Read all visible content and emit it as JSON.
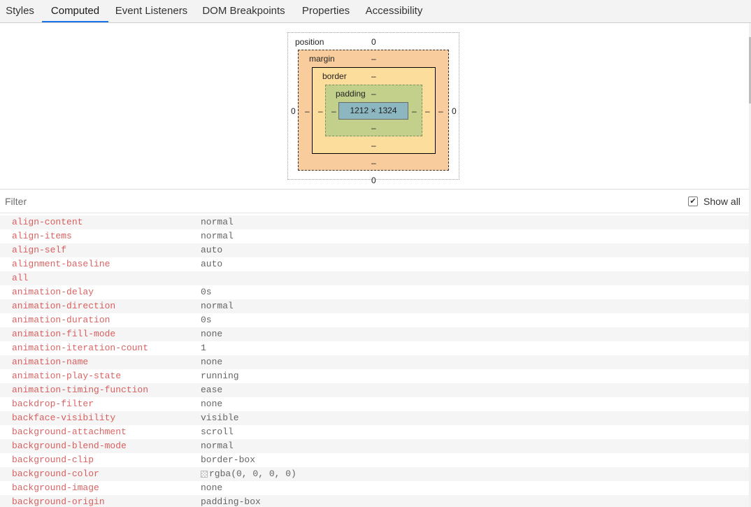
{
  "tabs": [
    {
      "label": "Styles"
    },
    {
      "label": "Computed"
    },
    {
      "label": "Event Listeners"
    },
    {
      "label": "DOM Breakpoints"
    },
    {
      "label": "Properties"
    },
    {
      "label": "Accessibility"
    }
  ],
  "active_tab": "Computed",
  "box_model": {
    "position_label": "position",
    "position_top": "0",
    "position_left": "0",
    "position_right": "0",
    "position_bottom": "0",
    "margin_label": "margin",
    "margin_top": "–",
    "margin_left": "–",
    "margin_right": "–",
    "margin_bottom": "–",
    "border_label": "border",
    "border_top": "–",
    "border_left": "–",
    "border_right": "–",
    "border_bottom": "–",
    "padding_label": "padding",
    "padding_top": "–",
    "padding_left": "–",
    "padding_right": "–",
    "padding_bottom": "–",
    "content_size": "1212 × 1324"
  },
  "filter": {
    "placeholder": "Filter",
    "value": ""
  },
  "show_all": {
    "label": "Show all",
    "checked": true,
    "check_glyph": "✔"
  },
  "properties": [
    {
      "name": "align-content",
      "value": "normal"
    },
    {
      "name": "align-items",
      "value": "normal"
    },
    {
      "name": "align-self",
      "value": "auto"
    },
    {
      "name": "alignment-baseline",
      "value": "auto"
    },
    {
      "name": "all",
      "value": ""
    },
    {
      "name": "animation-delay",
      "value": "0s"
    },
    {
      "name": "animation-direction",
      "value": "normal"
    },
    {
      "name": "animation-duration",
      "value": "0s"
    },
    {
      "name": "animation-fill-mode",
      "value": "none"
    },
    {
      "name": "animation-iteration-count",
      "value": "1"
    },
    {
      "name": "animation-name",
      "value": "none"
    },
    {
      "name": "animation-play-state",
      "value": "running"
    },
    {
      "name": "animation-timing-function",
      "value": "ease"
    },
    {
      "name": "backdrop-filter",
      "value": "none"
    },
    {
      "name": "backface-visibility",
      "value": "visible"
    },
    {
      "name": "background-attachment",
      "value": "scroll"
    },
    {
      "name": "background-blend-mode",
      "value": "normal"
    },
    {
      "name": "background-clip",
      "value": "border-box"
    },
    {
      "name": "background-color",
      "value": "rgba(0, 0, 0, 0)",
      "swatch": true
    },
    {
      "name": "background-image",
      "value": "none"
    },
    {
      "name": "background-origin",
      "value": "padding-box"
    }
  ],
  "colors": {
    "tab_active_underline": "#1a73e8",
    "property_name": "#c80000",
    "margin_fill": "#f9cc9d",
    "border_fill": "#fddd9b",
    "padding_fill": "#c3d08b",
    "content_fill": "#8cb6c0"
  }
}
